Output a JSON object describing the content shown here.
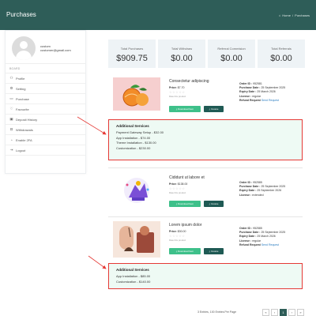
{
  "header": {
    "title": "Purchases",
    "breadcrumb": {
      "home": "Home",
      "separator": "/",
      "current": "Purchases"
    }
  },
  "sidebar": {
    "user_name": "custom",
    "user_email": "customer@gmail.com",
    "section_label": "BOARD",
    "items": [
      {
        "label": "Profile",
        "icon": "profile-icon"
      },
      {
        "label": "Setting",
        "icon": "gear-icon"
      },
      {
        "label": "Purchase",
        "icon": "purchase-icon"
      },
      {
        "label": "Favourite",
        "icon": "heart-icon"
      },
      {
        "label": "Deposit History",
        "icon": "history-icon"
      },
      {
        "label": "Withdrawals",
        "icon": "withdraw-icon"
      },
      {
        "label": "Enable 2FA",
        "icon": "lock-icon"
      },
      {
        "label": "Logout",
        "icon": "logout-icon"
      }
    ]
  },
  "stats": [
    {
      "label": "Total Purchases",
      "value": "$909.75"
    },
    {
      "label": "Total Withdraw",
      "value": "$0.00"
    },
    {
      "label": "Referral Commision",
      "value": "$0.00"
    },
    {
      "label": "Total Referrals",
      "value": "$0.00"
    }
  ],
  "orders": [
    {
      "name": "Consectetur adipiscing",
      "price_label": "Price:",
      "price": "$7.70",
      "stars": "☆☆☆☆☆",
      "rating_text": "Rate this product",
      "download_label": "Download Item",
      "invoice_label": "Invoice",
      "order_id_label": "Order ID :",
      "order_id": "952581",
      "purchase_date_label": "Purchase Date :",
      "purchase_date": "25 September 2025",
      "expiry_label": "Expiry Date :",
      "expiry": "25 March 2026",
      "license_label": "License :",
      "license": "regular",
      "refund_label": "Refund Request",
      "refund_link": "Send Request",
      "additional_title": "Additional Services",
      "additional": [
        "Payment Gateway Setup - $32.00",
        "App Installation - $74.00",
        "Theme Installation - $130.00",
        "Customization - $230.00"
      ]
    },
    {
      "name": "Cididunt ut labore et",
      "price_label": "Price:",
      "price": "$138.00",
      "stars": "☆☆☆☆☆",
      "rating_text": "Rate this product",
      "download_label": "Download Item",
      "invoice_label": "Invoice",
      "order_id_label": "Order ID :",
      "order_id": "952585",
      "purchase_date_label": "Purchase Date :",
      "purchase_date": "25 September 2025",
      "expiry_label": "Expiry Date :",
      "expiry": "25 September 2026",
      "license_label": "License :",
      "license": "extended"
    },
    {
      "name": "Lorem ipsum dolor",
      "price_label": "Price:",
      "price": "$30.00",
      "stars": "☆☆☆☆☆",
      "rating_text": "Rate this product",
      "download_label": "Download Item",
      "invoice_label": "Invoice",
      "order_id_label": "Order ID :",
      "order_id": "952585",
      "purchase_date_label": "Purchase Date :",
      "purchase_date": "25 September 2025",
      "expiry_label": "Expiry Date :",
      "expiry": "25 March 2026",
      "license_label": "License :",
      "license": "regular",
      "refund_label": "Refund Request",
      "refund_link": "Send Request",
      "additional_title": "Additional Services",
      "additional": [
        "App Installation - $85.00",
        "Customization - $140.00"
      ]
    }
  ],
  "pagination": {
    "info": "3 Entries, 100 Entries Per Page",
    "pages": [
      "«",
      "‹",
      "1",
      "›",
      "»"
    ],
    "active": "1"
  },
  "colors": {
    "header": "#2e5d58",
    "download": "#3ec08a",
    "invoice": "#1f5a54",
    "highlight_border": "#e53935"
  }
}
